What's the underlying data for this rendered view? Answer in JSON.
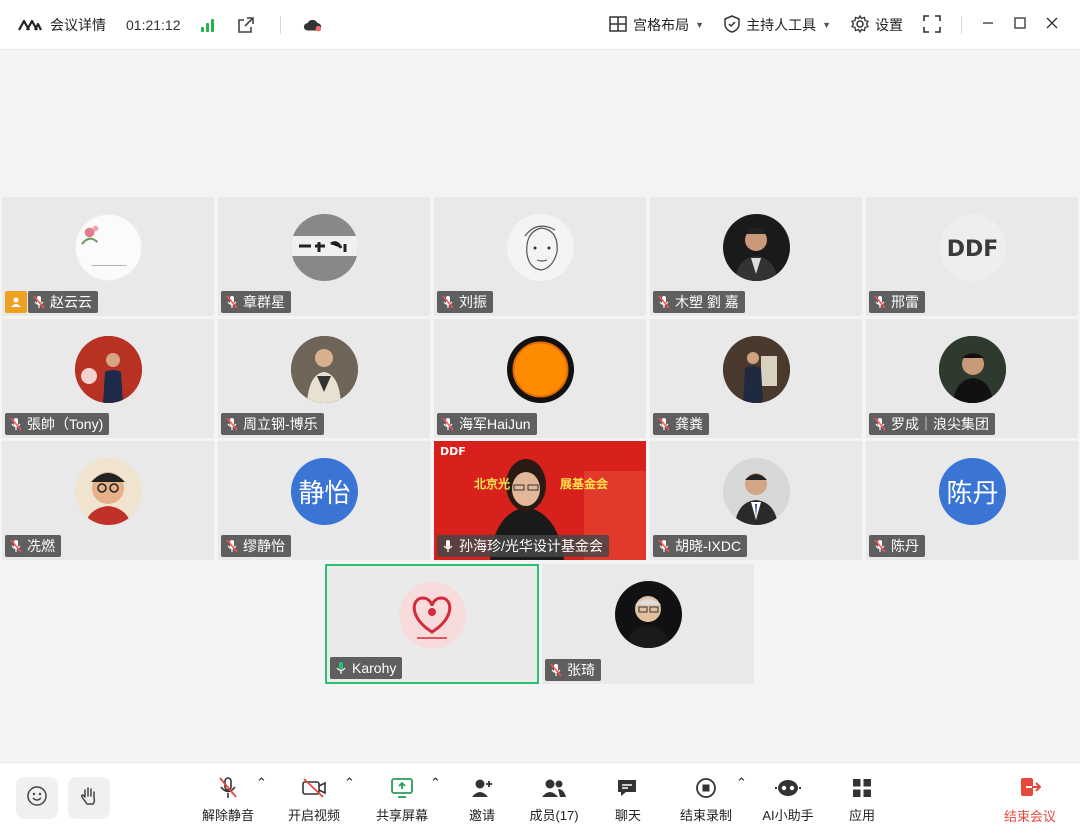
{
  "titlebar": {
    "title": "会议详情",
    "time": "01:21:12",
    "layout_label": "宫格布局",
    "host_tools_label": "主持人工具",
    "settings_label": "设置"
  },
  "participants": [
    {
      "name": "赵云云",
      "muted": true,
      "host": true
    },
    {
      "name": "章群星",
      "muted": true
    },
    {
      "name": "刘振",
      "muted": true
    },
    {
      "name": "木塑 劉 嘉",
      "muted": true
    },
    {
      "name": "邢雷",
      "muted": true
    },
    {
      "name": "張帥（Tony)",
      "muted": true
    },
    {
      "name": "周立钢-博乐",
      "muted": true
    },
    {
      "name": "海军HaiJun",
      "muted": true
    },
    {
      "name": "龚粪",
      "muted": true
    },
    {
      "name": "罗成｜浪尖集团",
      "muted": true
    },
    {
      "name": "冼燃",
      "muted": true
    },
    {
      "name": "缪静怡",
      "muted": true,
      "avatar_text": "静怡"
    },
    {
      "name": "孙海珍/光华设计基金会",
      "muted": false,
      "video": true
    },
    {
      "name": "胡晓-IXDC",
      "muted": true
    },
    {
      "name": "陈丹",
      "muted": true,
      "avatar_text": "陈丹"
    },
    {
      "name": "Karohy",
      "muted": false,
      "speaking": true
    },
    {
      "name": "张琦",
      "muted": true
    }
  ],
  "video_tile": {
    "banner_left": "北京光",
    "banner_right": "展基金会",
    "logo": "DDF"
  },
  "toolbar": {
    "unmute": "解除静音",
    "start_video": "开启视频",
    "share_screen": "共享屏幕",
    "invite": "邀请",
    "members": "成员(17)",
    "chat": "聊天",
    "end_recording": "结束录制",
    "ai_assistant": "AI小助手",
    "apps": "应用",
    "end_meeting": "结束会议"
  },
  "colors": {
    "accent_green": "#27b148",
    "end_red": "#e8483c",
    "host_orange": "#f0a020",
    "avatar_blue": "#3a74d4"
  }
}
